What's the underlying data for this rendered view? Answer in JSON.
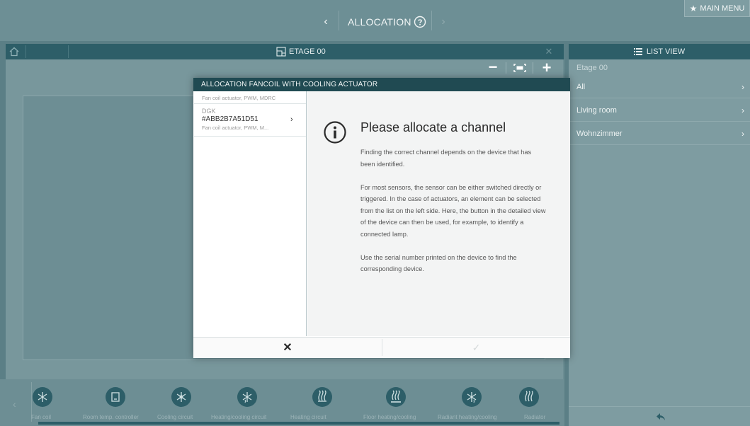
{
  "topbar": {
    "prev_icon": "chevron-left-icon",
    "prev_glyph": "‹",
    "title": "ALLOCATION",
    "help_icon": "help-circle-icon",
    "next_icon": "chevron-right-icon",
    "next_glyph": "›",
    "main_menu_icon": "star-icon",
    "main_menu_glyph": "★",
    "main_menu_label": "MAIN MENU"
  },
  "floor": {
    "home_icon": "home-icon",
    "floor_icon": "floor-plan-icon",
    "title": "ETAGE 00",
    "close_glyph": "✕"
  },
  "zoom": {
    "minus_glyph": "−",
    "plus_glyph": "+",
    "fit_icon": "fit-screen-icon"
  },
  "list_view": {
    "header_icon": "list-icon",
    "header_label": "LIST VIEW",
    "floor_label": "Etage 00",
    "items": [
      {
        "label": "All",
        "chevron": "›"
      },
      {
        "label": "Living room",
        "chevron": "›"
      },
      {
        "label": "Wohnzimmer",
        "chevron": "›"
      }
    ],
    "back_icon": "back-arrow-icon"
  },
  "bottom_strip": {
    "left_arrow": "‹",
    "device_icons": [
      {
        "icon": "fan-coil-icon",
        "label": "Fan coil"
      },
      {
        "icon": "thermostat-icon",
        "label": "Room temp. controller"
      },
      {
        "icon": "cooling-icon",
        "label": "Cooling circuit"
      },
      {
        "icon": "heating-cooling-icon",
        "label": "Heating/cooling circuit"
      },
      {
        "icon": "heating-icon",
        "label": "Heating circuit"
      },
      {
        "icon": "floor-heating-icon",
        "label": "Floor heating/cooling"
      },
      {
        "icon": "radiant-icon",
        "label": "Radiant heating/cooling"
      },
      {
        "icon": "radiator-icon",
        "label": "Radiator"
      }
    ]
  },
  "dialog": {
    "title": "ALLOCATION FANCOIL WITH COOLING ACTUATOR",
    "devices": [
      {
        "desc": "Fan coil actuator, PWM, MDRC"
      },
      {
        "type": "DGK",
        "serial": "#ABB2B7A51D51",
        "desc": "Fan coil actuator, PWM, M...",
        "chevron": "›"
      }
    ],
    "info_icon": "info-icon",
    "message_title": "Please allocate a channel",
    "paragraphs": [
      "Finding the correct channel depends on the device that has been identified.",
      "For most sensors, the sensor can be either switched directly or triggered. In the case of actuators, an element can be selected from the list on the left side. Here, the button in the detailed view of the device can then be used, for example, to identify a connected lamp.",
      "Use the serial number printed on the device to find the corresponding device."
    ],
    "cancel_glyph": "✕",
    "confirm_glyph": "✓"
  }
}
